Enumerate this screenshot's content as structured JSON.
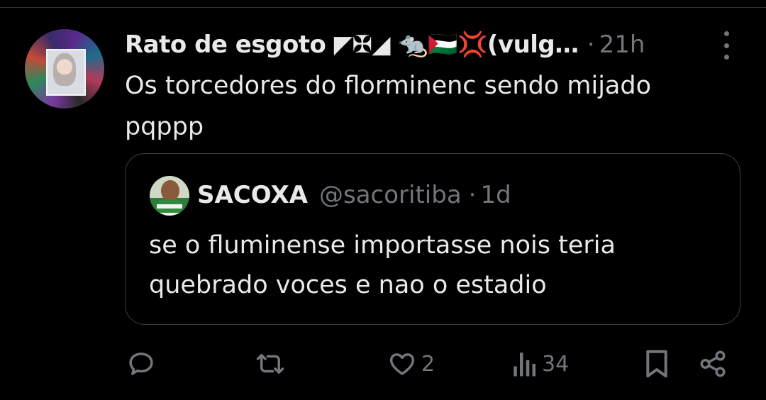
{
  "tweet": {
    "author_name": "Rato de esgoto ◤✠◢ 🐀🇵🇸💢(vulg…",
    "timestamp": "21h",
    "separator": "·",
    "text_line_1": "Os torcedores do florminenc sendo mijado",
    "text_line_2": "pqppp"
  },
  "quote": {
    "name": "SACOXA",
    "handle": "@sacoritiba",
    "separator": "·",
    "timestamp": "1d",
    "text_line_1": "se o fluminense importasse nois teria",
    "text_line_2": "quebrado voces e nao o estadio"
  },
  "actions": {
    "likes": "2",
    "views": "34"
  },
  "icons": {
    "reply": "reply-icon",
    "retweet": "retweet-icon",
    "like": "heart-icon",
    "views": "views-icon",
    "bookmark": "bookmark-icon",
    "share": "share-icon",
    "more": "more-icon"
  },
  "colors": {
    "background": "#000000",
    "text": "#e7e9ea",
    "muted": "#71767b",
    "border": "#2f3336"
  }
}
